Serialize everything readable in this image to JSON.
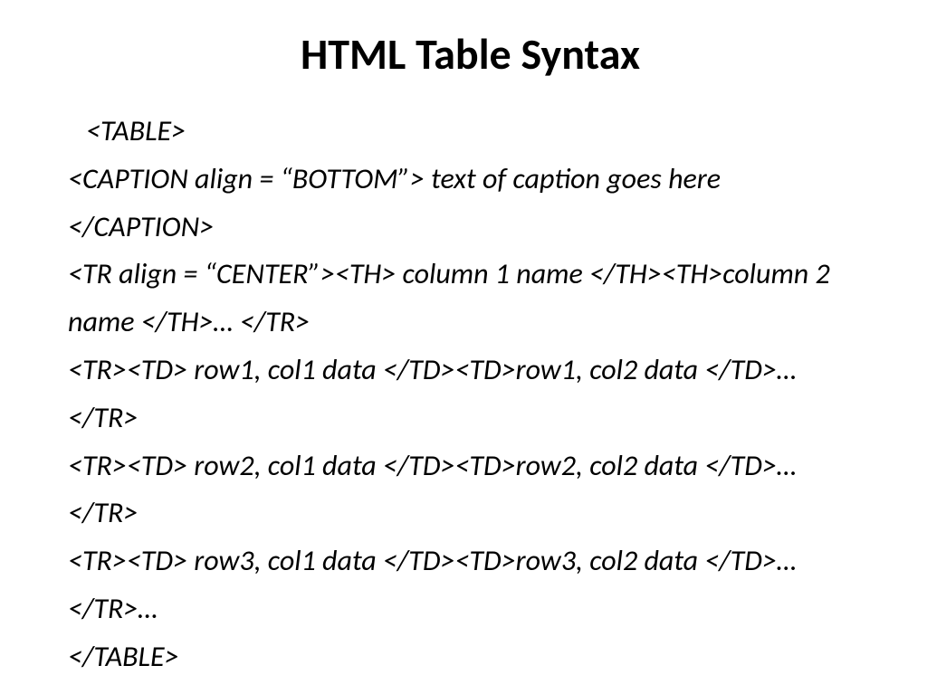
{
  "slide": {
    "title": "HTML Table Syntax",
    "lines": {
      "l1": "<TABLE>",
      "l2": "<CAPTION align = “BOTTOM”> text of caption goes here </CAPTION>",
      "l3": "<TR align = “CENTER”><TH> column 1 name </TH><TH>column 2 name </TH>… </TR>",
      "l4": "<TR><TD> row1, col1 data </TD><TD>row1, col2 data </TD>… </TR>",
      "l5": "<TR><TD> row2, col1 data </TD><TD>row2, col2 data </TD>… </TR>",
      "l6": "<TR><TD> row3, col1 data </TD><TD>row3, col2 data </TD>… </TR>…",
      "l7": "</TABLE>"
    }
  }
}
